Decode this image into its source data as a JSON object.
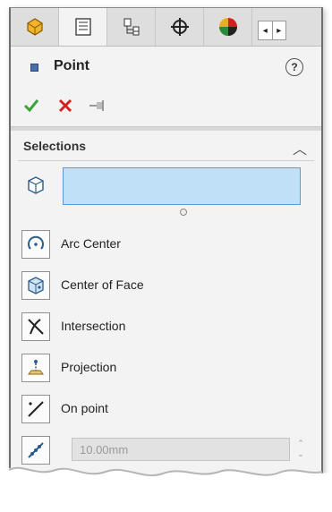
{
  "tabs": [
    {
      "icon": "feature-manager-icon",
      "active": false
    },
    {
      "icon": "property-manager-icon",
      "active": true
    },
    {
      "icon": "configuration-manager-icon",
      "active": false
    },
    {
      "icon": "dimxpert-manager-icon",
      "active": false
    },
    {
      "icon": "display-manager-icon",
      "active": false
    }
  ],
  "header": {
    "title": "Point",
    "help_symbol": "?"
  },
  "actions": {
    "ok_symbol": "✓",
    "cancel_symbol": "✕",
    "pin_symbol": "⊣"
  },
  "selections": {
    "title": "Selections",
    "box_value": "",
    "options": [
      {
        "label": "Arc Center",
        "icon": "arc-center-icon"
      },
      {
        "label": "Center of Face",
        "icon": "center-of-face-icon"
      },
      {
        "label": "Intersection",
        "icon": "intersection-icon"
      },
      {
        "label": "Projection",
        "icon": "projection-icon"
      },
      {
        "label": "On point",
        "icon": "on-point-icon"
      }
    ],
    "distance_value": "10.00mm"
  },
  "colors": {
    "selection_box": "#bfe0f7",
    "ok": "#3aa33a",
    "cancel": "#d92020"
  }
}
